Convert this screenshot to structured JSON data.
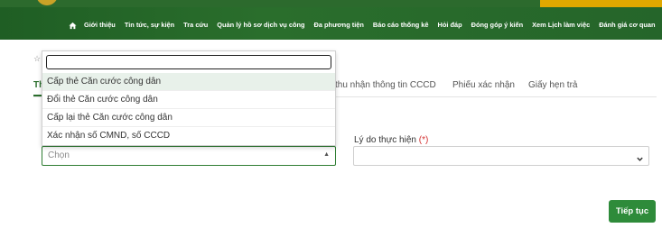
{
  "nav": {
    "items": [
      "Giới thiệu",
      "Tin tức, sự kiện",
      "Tra cứu",
      "Quản lý hồ sơ dịch vụ công",
      "Đa phương tiện",
      "Báo cáo thống kê",
      "Hỏi đáp",
      "Đóng góp ý kiến",
      "Xem Lịch làm việc",
      "Đánh giá cơ quan"
    ]
  },
  "tabs": {
    "first_partial": "Th",
    "items": [
      "thu nhận thông tin CCCD",
      "Phiếu xác nhận",
      "Giấy hẹn trả"
    ]
  },
  "procedure_select": {
    "placeholder": "Chọn",
    "options": [
      "Cấp thẻ Căn cước công dân",
      "Đổi thẻ Căn cước công dân",
      "Cấp lại thẻ Căn cước công dân",
      "Xác nhận số CMND, số CCCD"
    ],
    "search_value": ""
  },
  "reason": {
    "label": "Lý do thực hiện",
    "required_mark": "(*)",
    "value": ""
  },
  "next_button": "Tiếp tục",
  "colors": {
    "header_green": "#2a6e2c",
    "accent_gold": "#e0a800",
    "button_green": "#2e8b3a",
    "required_red": "#d32f2f"
  }
}
